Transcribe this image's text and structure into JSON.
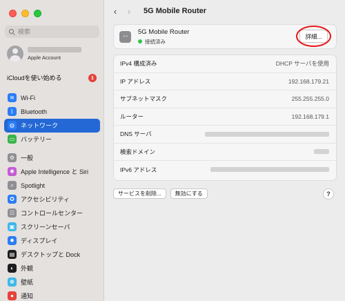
{
  "window": {
    "title": "5G Mobile Router"
  },
  "sidebar": {
    "search_placeholder": "検索",
    "account": {
      "subtitle": "Apple Account"
    },
    "icloud": {
      "label": "iCloudを使い始める",
      "badge": "1"
    },
    "groups": [
      [
        {
          "label": "Wi-Fi",
          "icon": "wifi-icon",
          "color": "#2b7cf5",
          "glyph": "≋"
        },
        {
          "label": "Bluetooth",
          "icon": "bluetooth-icon",
          "color": "#2b7cf5",
          "glyph": "ᛒ"
        },
        {
          "label": "ネットワーク",
          "icon": "network-globe-icon",
          "color": "#2b7cf5",
          "glyph": "◍",
          "selected": true
        },
        {
          "label": "バッテリー",
          "icon": "battery-icon",
          "color": "#38b34a",
          "glyph": "▭"
        }
      ],
      [
        {
          "label": "一般",
          "icon": "gear-icon",
          "color": "#8e8e93",
          "glyph": "⚙"
        },
        {
          "label": "Apple Intelligence と Siri",
          "icon": "siri-icon",
          "color": "#c45bd6",
          "glyph": "✺"
        },
        {
          "label": "Spotlight",
          "icon": "spotlight-icon",
          "color": "#8e8e93",
          "glyph": "⌕"
        },
        {
          "label": "アクセシビリティ",
          "icon": "accessibility-icon",
          "color": "#2b7cf5",
          "glyph": "✪"
        },
        {
          "label": "コントロールセンター",
          "icon": "control-center-icon",
          "color": "#8e8e93",
          "glyph": "☷"
        },
        {
          "label": "スクリーンセーバ",
          "icon": "screensaver-icon",
          "color": "#3fb7e8",
          "glyph": "▣"
        },
        {
          "label": "ディスプレイ",
          "icon": "display-icon",
          "color": "#2b7cf5",
          "glyph": "✹"
        },
        {
          "label": "デスクトップと Dock",
          "icon": "dock-icon",
          "color": "#1d1d1f",
          "glyph": "▤"
        },
        {
          "label": "外観",
          "icon": "appearance-icon",
          "color": "#1d1d1f",
          "glyph": "◐"
        },
        {
          "label": "壁紙",
          "icon": "wallpaper-icon",
          "color": "#3fb7e8",
          "glyph": "❁"
        },
        {
          "label": "通知",
          "icon": "notifications-icon",
          "color": "#e5413a",
          "glyph": "●"
        }
      ]
    ]
  },
  "toolbar": {
    "back_glyph": "‹",
    "forward_glyph": "›"
  },
  "service": {
    "name": "5G Mobile Router",
    "status": "接続済み",
    "icon_glyph": "‹··›",
    "details_button": "詳細...",
    "status_color": "#33c24a"
  },
  "info_rows": [
    {
      "label": "IPv4 構成済み",
      "value": "DHCP サーバを使用"
    },
    {
      "label": "IP アドレス",
      "value": "192.168.179.21"
    },
    {
      "label": "サブネットマスク",
      "value": "255.255.255.0"
    },
    {
      "label": "ルーター",
      "value": "192.168.179.1"
    },
    {
      "label": "DNS サーバ",
      "value": null,
      "redacted_width": 180
    },
    {
      "label": "検索ドメイン",
      "value": null,
      "redacted_width": 22
    },
    {
      "label": "IPv6 アドレス",
      "value": null,
      "redacted_width": 172
    }
  ],
  "buttons": {
    "remove_service": "サービスを削除...",
    "disable": "無効にする",
    "help": "?"
  },
  "colors": {
    "accent": "#2468d5",
    "highlight": "#e8161d"
  }
}
